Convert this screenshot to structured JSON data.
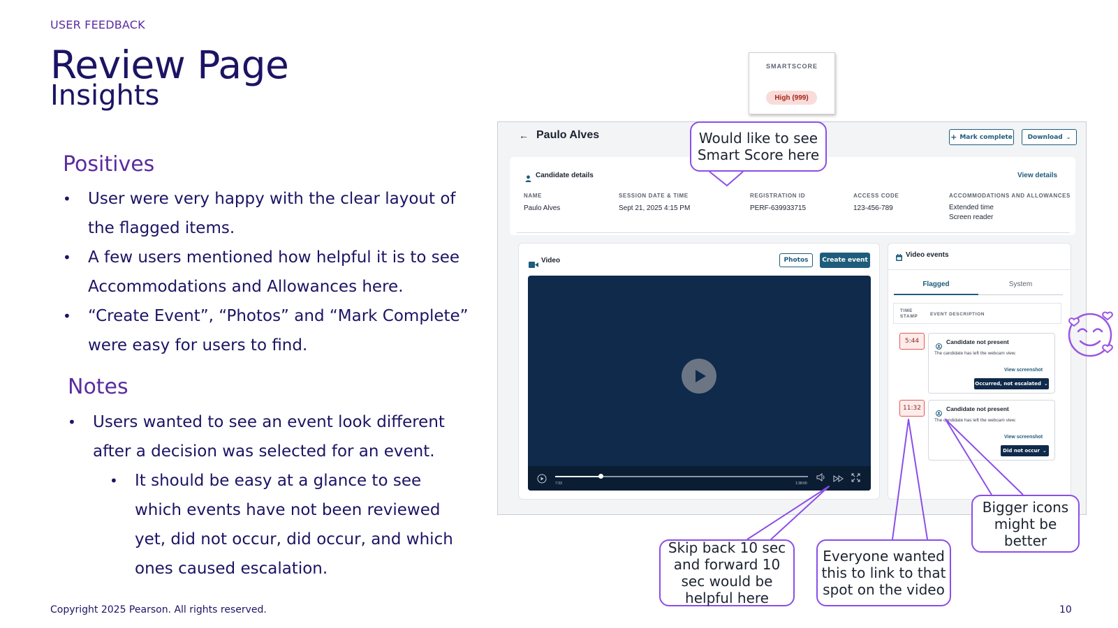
{
  "slide": {
    "eyebrow": "USER FEEDBACK",
    "title": "Review Page",
    "subtitle": "Insights",
    "positives_heading": "Positives",
    "positives": [
      "User were very happy with the clear layout of the flagged items.",
      "A few users mentioned how helpful it is to see Accommodations and Allowances here.",
      "“Create Event”, “Photos” and “Mark Complete” were easy for users to find."
    ],
    "notes_heading": "Notes",
    "notes": [
      "Users wanted to see an event look different after a decision was selected for an event."
    ],
    "subnotes": [
      "It should be easy at a glance to see which events have not been reviewed yet, did not occur, did occur, and which ones caused escalation."
    ],
    "footer": "Copyright 2025 Pearson. All rights reserved.",
    "page_number": "10"
  },
  "smartscore": {
    "label": "SMARTSCORE",
    "value": "High (999)"
  },
  "review_ui": {
    "candidate_name": "Paulo Alves",
    "mark_complete": "Mark complete",
    "download": "Download",
    "candidate_details": "Candidate details",
    "view_details": "View details",
    "fields": [
      {
        "label": "NAME",
        "value": "Paulo Alves"
      },
      {
        "label": "SESSION DATE & TIME",
        "value": "Sept 21, 2025 4:15 PM"
      },
      {
        "label": "REGISTRATION ID",
        "value": "PERF-639933715"
      },
      {
        "label": "ACCESS CODE",
        "value": "123-456-789"
      },
      {
        "label": "ACCOMMODATIONS AND ALLOWANCES",
        "value": "Extended time",
        "value2": "Screen reader"
      }
    ],
    "video_title": "Video",
    "photos": "Photos",
    "create_event": "Create event",
    "time_current": "7:33",
    "time_total": "1:38:00",
    "playback_progress": 0.18,
    "events_title": "Video events",
    "tab_flagged": "Flagged",
    "tab_system": "System",
    "col_timestamp_1": "TIME",
    "col_timestamp_2": "STAMP",
    "col_description": "EVENT DESCRIPTION",
    "events": [
      {
        "time": "5:44",
        "title": "Candidate not present",
        "desc": "The candidate has left the webcam view.",
        "link": "View screenshot",
        "status": "Occurred, not escalated"
      },
      {
        "time": "11:32",
        "title": "Candidate not present",
        "desc": "The candidate has left the webcam view.",
        "link": "View screenshot",
        "status": "Did not occur"
      }
    ]
  },
  "callouts": {
    "smartscore": "Would like to see Smart Score here",
    "skip": "Skip back 10 sec and forward 10 sec would be helpful here",
    "link": "Everyone wanted this to link to that spot on the video",
    "icons": "Bigger icons might be better"
  },
  "colors": {
    "accent": "#5a2ca0",
    "navy": "#1b1464",
    "callout": "#8b4ee8",
    "button": "#1e5c7b",
    "player": "#0f2a4a"
  }
}
